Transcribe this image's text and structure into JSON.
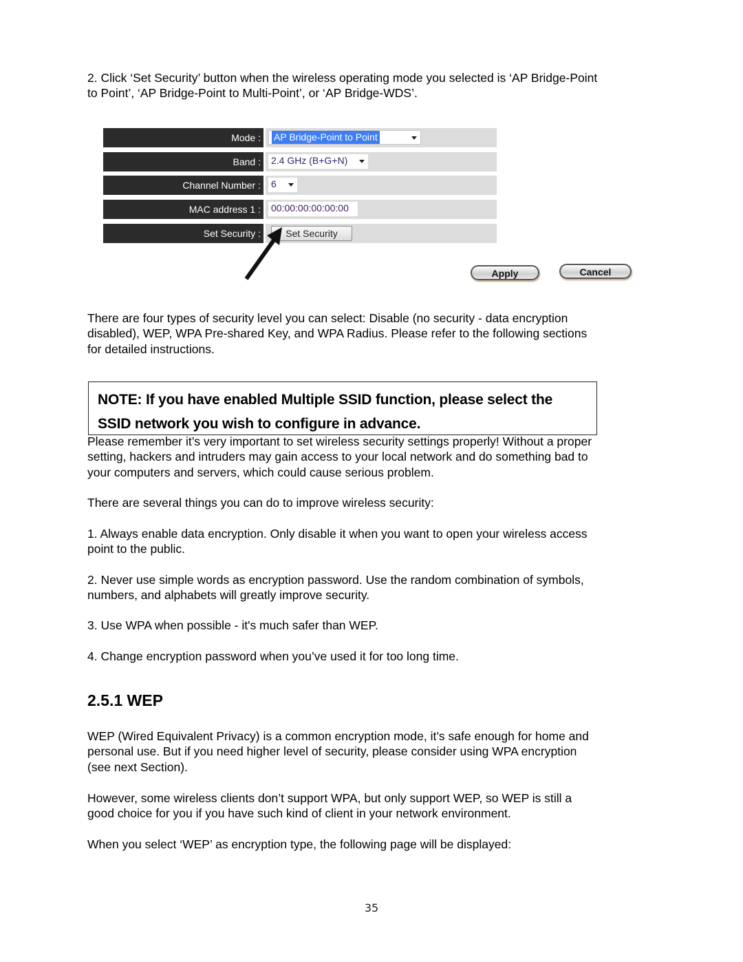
{
  "intro": {
    "lines": [
      "2. Click ‘Set Security’ button when the wireless operating mode you selected is ‘AP Bridge-Point",
      "to Point’, ‘AP Bridge-Point to Multi-Point’, or ‘AP Bridge-WDS’."
    ]
  },
  "form": {
    "rows": [
      {
        "label": "Mode :",
        "value": "AP Bridge-Point to Point",
        "type": "select",
        "highlighted": true
      },
      {
        "label": "Band :",
        "value": "2.4 GHz (B+G+N)",
        "type": "select"
      },
      {
        "label": "Channel Number :",
        "value": "6",
        "type": "select"
      },
      {
        "label": "MAC address 1 :",
        "value": "00:00:00:00:00:00",
        "type": "text"
      },
      {
        "label": "Set Security :",
        "value": "Set Security",
        "type": "button"
      }
    ],
    "apply_label": "Apply",
    "cancel_label": "Cancel",
    "arrow_icon": "arrow-pointer-icon",
    "colors": {
      "label_bg": "#2b2b2b",
      "value_bg": "#dcdcdc",
      "highlight": "#3d7ef5"
    }
  },
  "security_types": {
    "lines": [
      "There are four types of security level you can select: Disable (no security - data encryption",
      "disabled), WEP, WPA Pre-shared Key, and WPA Radius. Please refer to the following sections",
      "for detailed instructions."
    ]
  },
  "note": {
    "lines": [
      "NOTE: If you have enabled Multiple SSID function, please select the",
      "SSID network you wish to configure in advance."
    ]
  },
  "remember": {
    "lines": [
      "Please remember it’s very important to set wireless security settings properly! Without a proper",
      "setting, hackers and intruders may gain access to your local network and do something bad to",
      "your computers and servers, which could cause serious problem."
    ]
  },
  "tips": {
    "intro": "There are several things you can do to improve wireless security:",
    "items": [
      {
        "lines": [
          "1. Always enable data encryption. Only disable it when you want to open your wireless access",
          "point to the public."
        ]
      },
      {
        "lines": [
          "2. Never use simple words as encryption password. Use the random combination of symbols,",
          "numbers, and alphabets will greatly improve security."
        ]
      },
      {
        "lines": [
          "3. Use WPA when possible - it's much safer than WEP."
        ]
      },
      {
        "lines": [
          "4. Change encryption password when you’ve used it for too long time."
        ]
      }
    ]
  },
  "wep": {
    "heading": "2.5.1 WEP",
    "p1": [
      "WEP (Wired Equivalent Privacy) is a common encryption mode, it’s safe enough for home and",
      "personal use. But if you need higher level of security, please consider using WPA encryption",
      "(see next Section)."
    ],
    "p2": [
      "However, some wireless clients don’t support WPA, but only support WEP, so WEP is still a",
      "good choice for you if you have such kind of client in your network environment."
    ],
    "p3": [
      "When you select ‘WEP’ as encryption type, the following page will be displayed:"
    ]
  },
  "page_number": "35"
}
